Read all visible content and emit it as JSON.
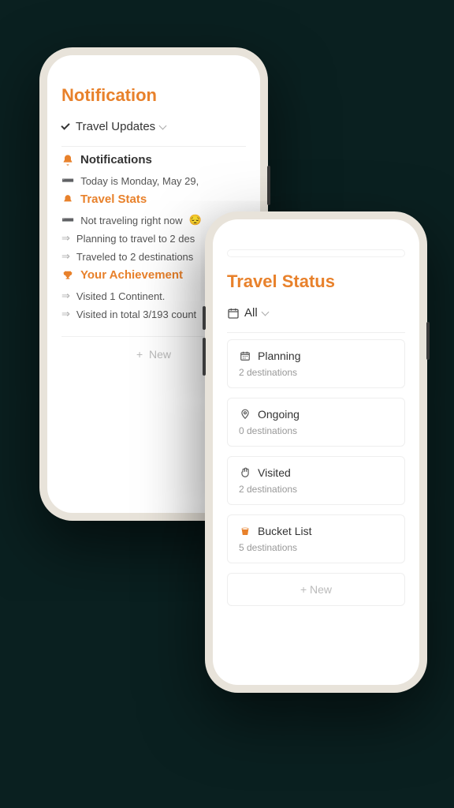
{
  "left": {
    "title": "Notification",
    "header": "Travel Updates",
    "notifications_title": "Notifications",
    "today_line": "Today is Monday, May 29,",
    "stats_title": "Travel Stats",
    "stat_not_traveling": "Not traveling right now",
    "stat_planning": "Planning to travel to 2 des",
    "stat_traveled": "Traveled to 2 destinations",
    "achievement_title": "Your Achievement",
    "ach_continent": "Visited 1 Continent.",
    "ach_total": "Visited in total 3/193 count",
    "new_label": "New"
  },
  "right": {
    "title": "Travel Status",
    "header": "All",
    "cards": [
      {
        "title": "Planning",
        "sub": "2 destinations"
      },
      {
        "title": "Ongoing",
        "sub": "0 destinations"
      },
      {
        "title": "Visited",
        "sub": "2 destinations"
      },
      {
        "title": "Bucket List",
        "sub": "5 destinations"
      }
    ],
    "new_label": "New"
  }
}
